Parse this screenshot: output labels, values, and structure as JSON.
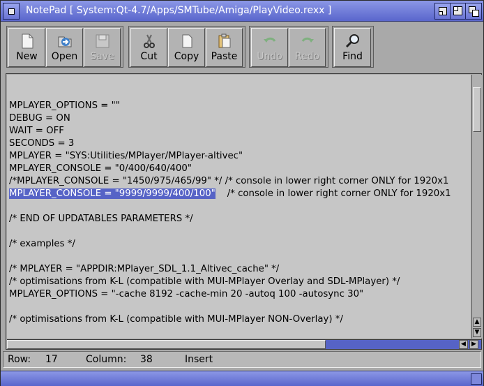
{
  "window": {
    "title": "NotePad [ System:Qt-4.7/Apps/SMTube/Amiga/PlayVideo.rexx ]",
    "accent": "#5663c6"
  },
  "toolbar": {
    "buttons": [
      {
        "label": "New",
        "icon": "new-file-icon",
        "enabled": true
      },
      {
        "label": "Open",
        "icon": "open-icon",
        "enabled": true
      },
      {
        "label": "Save",
        "icon": "save-icon",
        "enabled": false
      },
      {
        "label": "Cut",
        "icon": "scissors-icon",
        "enabled": true
      },
      {
        "label": "Copy",
        "icon": "copy-icon",
        "enabled": true
      },
      {
        "label": "Paste",
        "icon": "paste-icon",
        "enabled": true
      },
      {
        "label": "Undo",
        "icon": "undo-icon",
        "enabled": false
      },
      {
        "label": "Redo",
        "icon": "redo-icon",
        "enabled": false
      },
      {
        "label": "Find",
        "icon": "magnifier-icon",
        "enabled": true
      }
    ]
  },
  "editor": {
    "lines": [
      "MPLAYER_OPTIONS = \"\"",
      "DEBUG = ON",
      "WAIT = OFF",
      "SECONDS = 3",
      "MPLAYER = \"SYS:Utilities/MPlayer/MPlayer-altivec\"",
      "MPLAYER_CONSOLE = \"0/400/640/400\"",
      "/*MPLAYER_CONSOLE = \"1450/975/465/99\" */ /* console in lower right corner ONLY for 1920x1",
      "MPLAYER_CONSOLE = \"9999/9999/400/100\"",
      "",
      "/* END OF UPDATABLES PARAMETERS */",
      "",
      "/* examples */",
      "",
      "/* MPLAYER = \"APPDIR:MPlayer_SDL_1.1_Altivec_cache\" */",
      "/* optimisations from K-L (compatible with MUI-MPlayer Overlay and SDL-MPlayer) */",
      "MPLAYER_OPTIONS = \"-cache 8192 -cache-min 20 -autoq 100 -autosync 30\"",
      "",
      "/* optimisations from K-L (compatible with MUI-MPlayer NON-Overlay) */"
    ],
    "selected_text": "MPLAYER_CONSOLE = \"9999/9999/400/100\"",
    "selected_line_rest": "    /* console in lower right corner ONLY for 1920x1"
  },
  "status": {
    "row_label": "Row:",
    "row_value": "17",
    "column_label": "Column:",
    "column_value": "38",
    "mode": "Insert"
  }
}
